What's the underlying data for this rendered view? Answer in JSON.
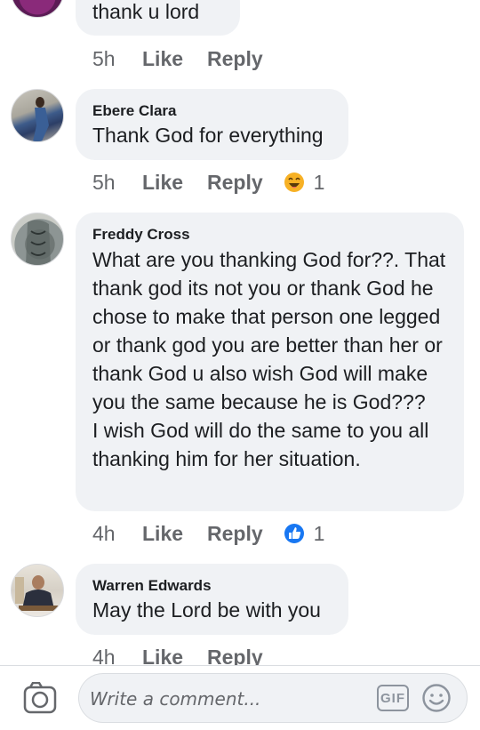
{
  "comments": [
    {
      "name": "",
      "text": "thank u lord",
      "time": "5h",
      "like": "Like",
      "reply": "Reply",
      "reaction_count": ""
    },
    {
      "name": "Ebere Clara",
      "text": "Thank God for everything",
      "time": "5h",
      "like": "Like",
      "reply": "Reply",
      "reaction": "haha-icon",
      "reaction_count": "1"
    },
    {
      "name": "Freddy Cross",
      "text": "What are you thanking God for??. That thank god its not you or thank God he chose to make that person one legged or thank god you are better than her or thank God u also wish God will make you the same because he is God???\nI wish God will do the same to you all thanking him for her situation.",
      "time": "4h",
      "like": "Like",
      "reply": "Reply",
      "reaction": "like-icon",
      "reaction_count": "1"
    },
    {
      "name": "Warren Edwards",
      "text": "May the Lord be with you",
      "time": "4h",
      "like": "Like",
      "reply": "Reply",
      "reaction_count": ""
    }
  ],
  "composer": {
    "placeholder": "Write a comment...",
    "gif_label": "GIF",
    "icons": [
      "camera-icon",
      "gif-icon",
      "emoji-icon"
    ]
  },
  "colors": {
    "bubble": "#f0f2f5",
    "meta": "#65676b",
    "like_blue": "#1877f2",
    "haha_yellow": "#f7b125"
  }
}
